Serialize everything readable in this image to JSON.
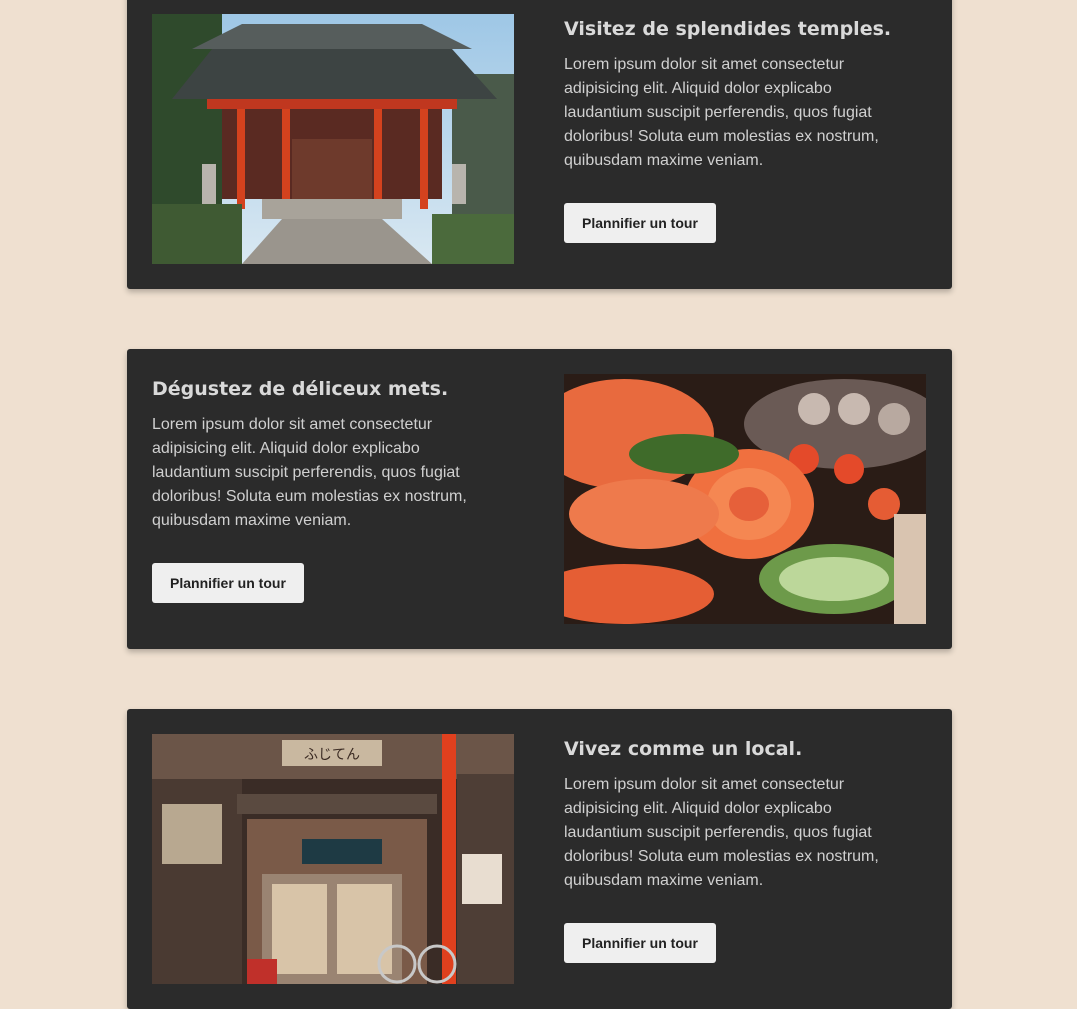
{
  "cards": [
    {
      "title": "Visitez de splendides temples.",
      "body": "Lorem ipsum dolor sit amet consectetur adipisicing elit. Aliquid dolor explicabo laudantium suscipit perferendis, quos fugiat doloribus! Soluta eum molestias ex nostrum, quibusdam maxime veniam.",
      "button": "Plannifier un tour",
      "image": "temple-photo"
    },
    {
      "title": "Dégustez de déliceux mets.",
      "body": "Lorem ipsum dolor sit amet consectetur adipisicing elit. Aliquid dolor explicabo laudantium suscipit perferendis, quos fugiat doloribus! Soluta eum molestias ex nostrum, quibusdam maxime veniam.",
      "button": "Plannifier un tour",
      "image": "sushi-photo"
    },
    {
      "title": "Vivez comme un local.",
      "body": "Lorem ipsum dolor sit amet consectetur adipisicing elit. Aliquid dolor explicabo laudantium suscipit perferendis, quos fugiat doloribus! Soluta eum molestias ex nostrum, quibusdam maxime veniam.",
      "button": "Plannifier un tour",
      "image": "street-shop-photo",
      "sign_text": "ふじてん"
    }
  ],
  "colors": {
    "page_background": "#efe0d0",
    "card_background": "#2b2b2b",
    "button_background": "#efefef"
  }
}
